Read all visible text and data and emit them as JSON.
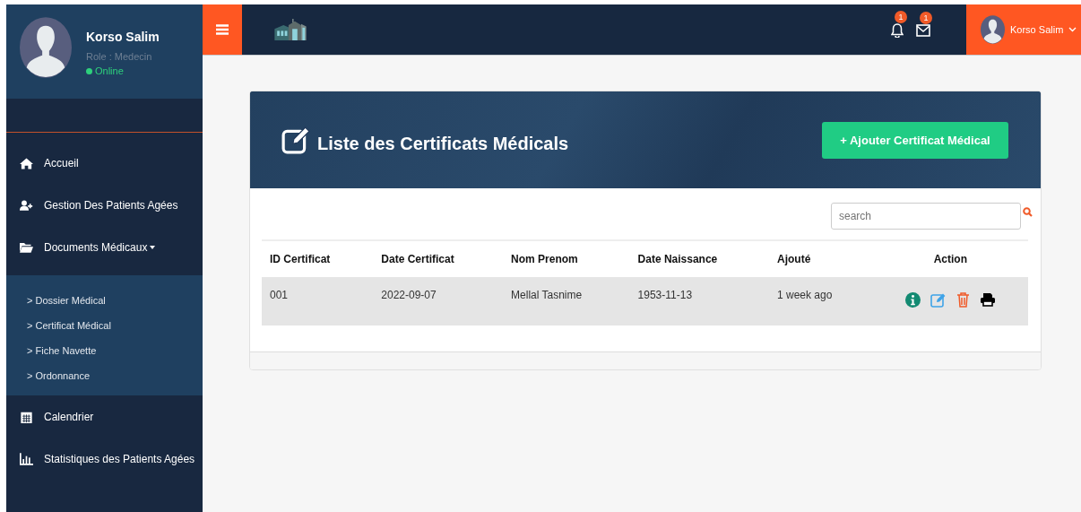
{
  "sidebar": {
    "user": {
      "name": "Korso Salim",
      "role": "Role : Medecin",
      "status": "Online"
    },
    "items": [
      {
        "label": "Accueil"
      },
      {
        "label": "Gestion Des Patients Agées"
      },
      {
        "label": "Documents Médicaux",
        "expanded": true,
        "children": [
          {
            "label": "> Dossier Médical"
          },
          {
            "label": "> Certificat Médical"
          },
          {
            "label": "> Fiche Navette"
          },
          {
            "label": "> Ordonnance"
          }
        ]
      },
      {
        "label": "Calendrier"
      },
      {
        "label": "Statistiques des Patients Agées"
      }
    ]
  },
  "topbar": {
    "notifications": "1",
    "messages": "1",
    "user": "Korso Salim"
  },
  "card": {
    "title": "Liste des Certificats Médicals",
    "add_button": "+ Ajouter Certificat Médical",
    "search": {
      "placeholder": "search"
    },
    "table": {
      "columns": [
        "ID Certificat",
        "Date Certificat",
        "Nom Prenom",
        "Date Naissance",
        "Ajouté",
        "Action"
      ],
      "rows": [
        {
          "cells": [
            "001",
            "2022-09-07",
            "Mellal Tasnime",
            "1953-11-13",
            "1 week ago"
          ]
        }
      ]
    }
  }
}
